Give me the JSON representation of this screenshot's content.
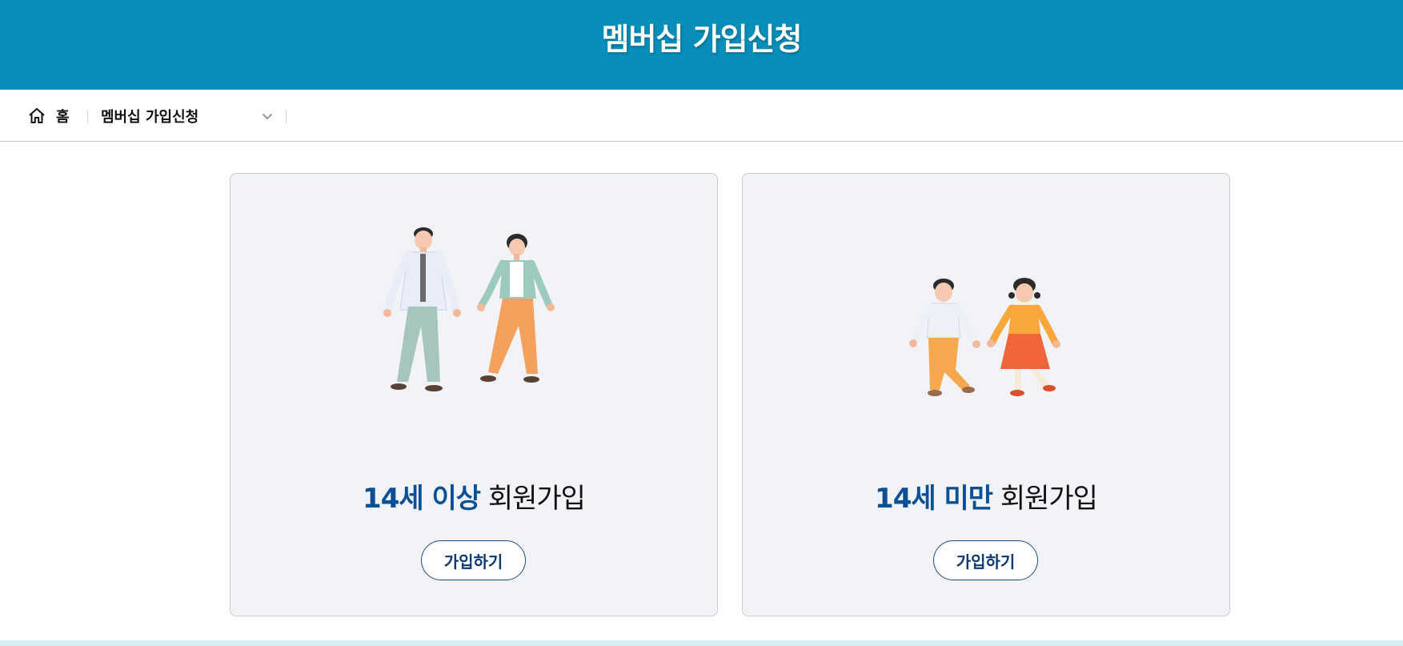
{
  "page": {
    "title": "멤버십 가입신청",
    "header_color": "#078fba"
  },
  "breadcrumb": {
    "home_label": "홈",
    "home_icon": "home-icon",
    "current_label": "멤버십 가입신청",
    "dropdown_icon": "chevron-down-icon"
  },
  "cards": [
    {
      "illustration": "adult-couple-illustration",
      "title_highlight": "14세 이상",
      "title_rest": " 회원가입",
      "button_label": "가입하기"
    },
    {
      "illustration": "children-illustration",
      "title_highlight": "14세 미만",
      "title_rest": " 회원가입",
      "button_label": "가입하기"
    }
  ],
  "colors": {
    "accent": "#0b4f95",
    "card_background": "#f1f3f7"
  }
}
